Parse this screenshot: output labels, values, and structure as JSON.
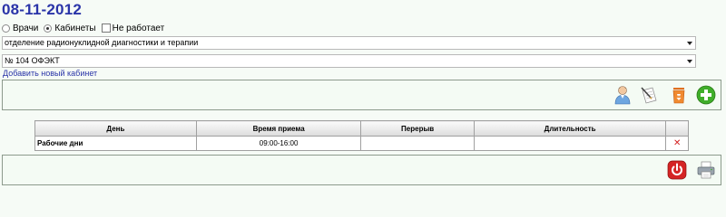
{
  "header": {
    "date": "08-11-2012"
  },
  "mode": {
    "doctors_label": "Врачи",
    "cabinets_label": "Кабинеты",
    "not_working_label": "Не работает",
    "selected": "cabinets"
  },
  "department_select": {
    "value": "отделение радионуклидной диагностики и терапии"
  },
  "cabinet_select": {
    "value": "№ 104 ОФЭКТ"
  },
  "add_cabinet_link": "Добавить новый кабинет",
  "toolbar_icons": [
    "doctor-icon",
    "edit-document-icon",
    "trash-icon",
    "add-icon"
  ],
  "schedule": {
    "columns": [
      "День",
      "Время приема",
      "Перерыв",
      "Длительность",
      ""
    ],
    "rows": [
      {
        "day": "Рабочие дни",
        "time": "09:00-16:00",
        "break": "",
        "duration": "",
        "delete": "✕"
      }
    ]
  },
  "bottom_icons": [
    "power-icon",
    "printer-icon"
  ],
  "colors": {
    "accent": "#2a34a8",
    "panel_border": "#8c9a8c",
    "delete": "#d42020"
  }
}
